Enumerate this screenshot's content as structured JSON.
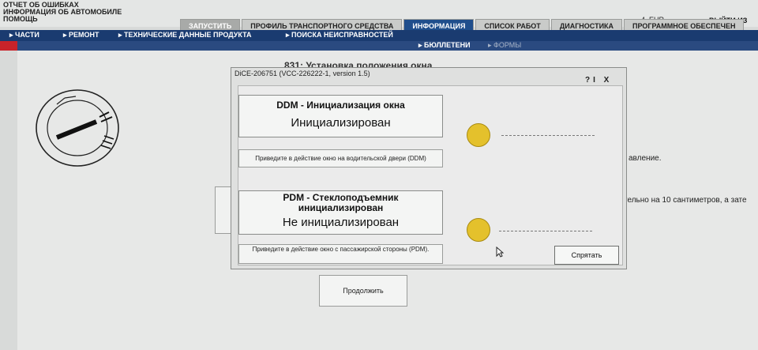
{
  "topmenu": {
    "line1": "ОТЧЕТ ОБ ОШИБКАХ",
    "line2": "ИНФОРМАЦИЯ ОБ АВТОМОБИЛЕ",
    "line3": "ПОМОЩЬ"
  },
  "header": {
    "currency": "4, EUR",
    "logout": "ВЫЙТИ ИЗ"
  },
  "tabs": [
    "ЗАПУСТИТЬ",
    "ПРОФИЛЬ ТРАНСПОРТНОГО СРЕДСТВА",
    "ИНФОРМАЦИЯ",
    "СПИСОК РАБОТ",
    "ДИАГНОСТИКА",
    "ПРОГРАММНОЕ ОБЕСПЕЧЕН"
  ],
  "nav": [
    "ЧАСТИ",
    "РЕМОНТ",
    "ТЕХНИЧЕСКИЕ ДАННЫЕ ПРОДУКТА",
    "ПОИСКА НЕИСПРАВНОСТЕЙ"
  ],
  "subnav": [
    "БЮЛЛЕТЕНИ",
    "ФОРМЫ"
  ],
  "main": {
    "heading": "831: Установка положения окна",
    "text_right": "авление.",
    "text_right2": "тельно на 10 сантиметров, а зате",
    "continue_label": "Продолжить"
  },
  "dialog": {
    "title": "DiCE-206751   (VCC-226222-1, version 1.5)",
    "buttons": "?I X",
    "ddm": {
      "title": "DDM - Инициализация окна",
      "status": "Инициализирован",
      "action": "Приведите в действие окно на водительской двери (DDM)"
    },
    "pdm": {
      "title": "PDM - Стеклоподъемник инициализирован",
      "status": "Не инициализирован",
      "action": "Приведите в действие окно с пассажирской стороны (PDM)."
    },
    "hide_label": "Спрятать",
    "led_color": "#e4c12c"
  },
  "colors": {
    "navbar": "#1a3b70",
    "active_tab": "#1f4e8c",
    "accent_red": "#c8232a"
  }
}
